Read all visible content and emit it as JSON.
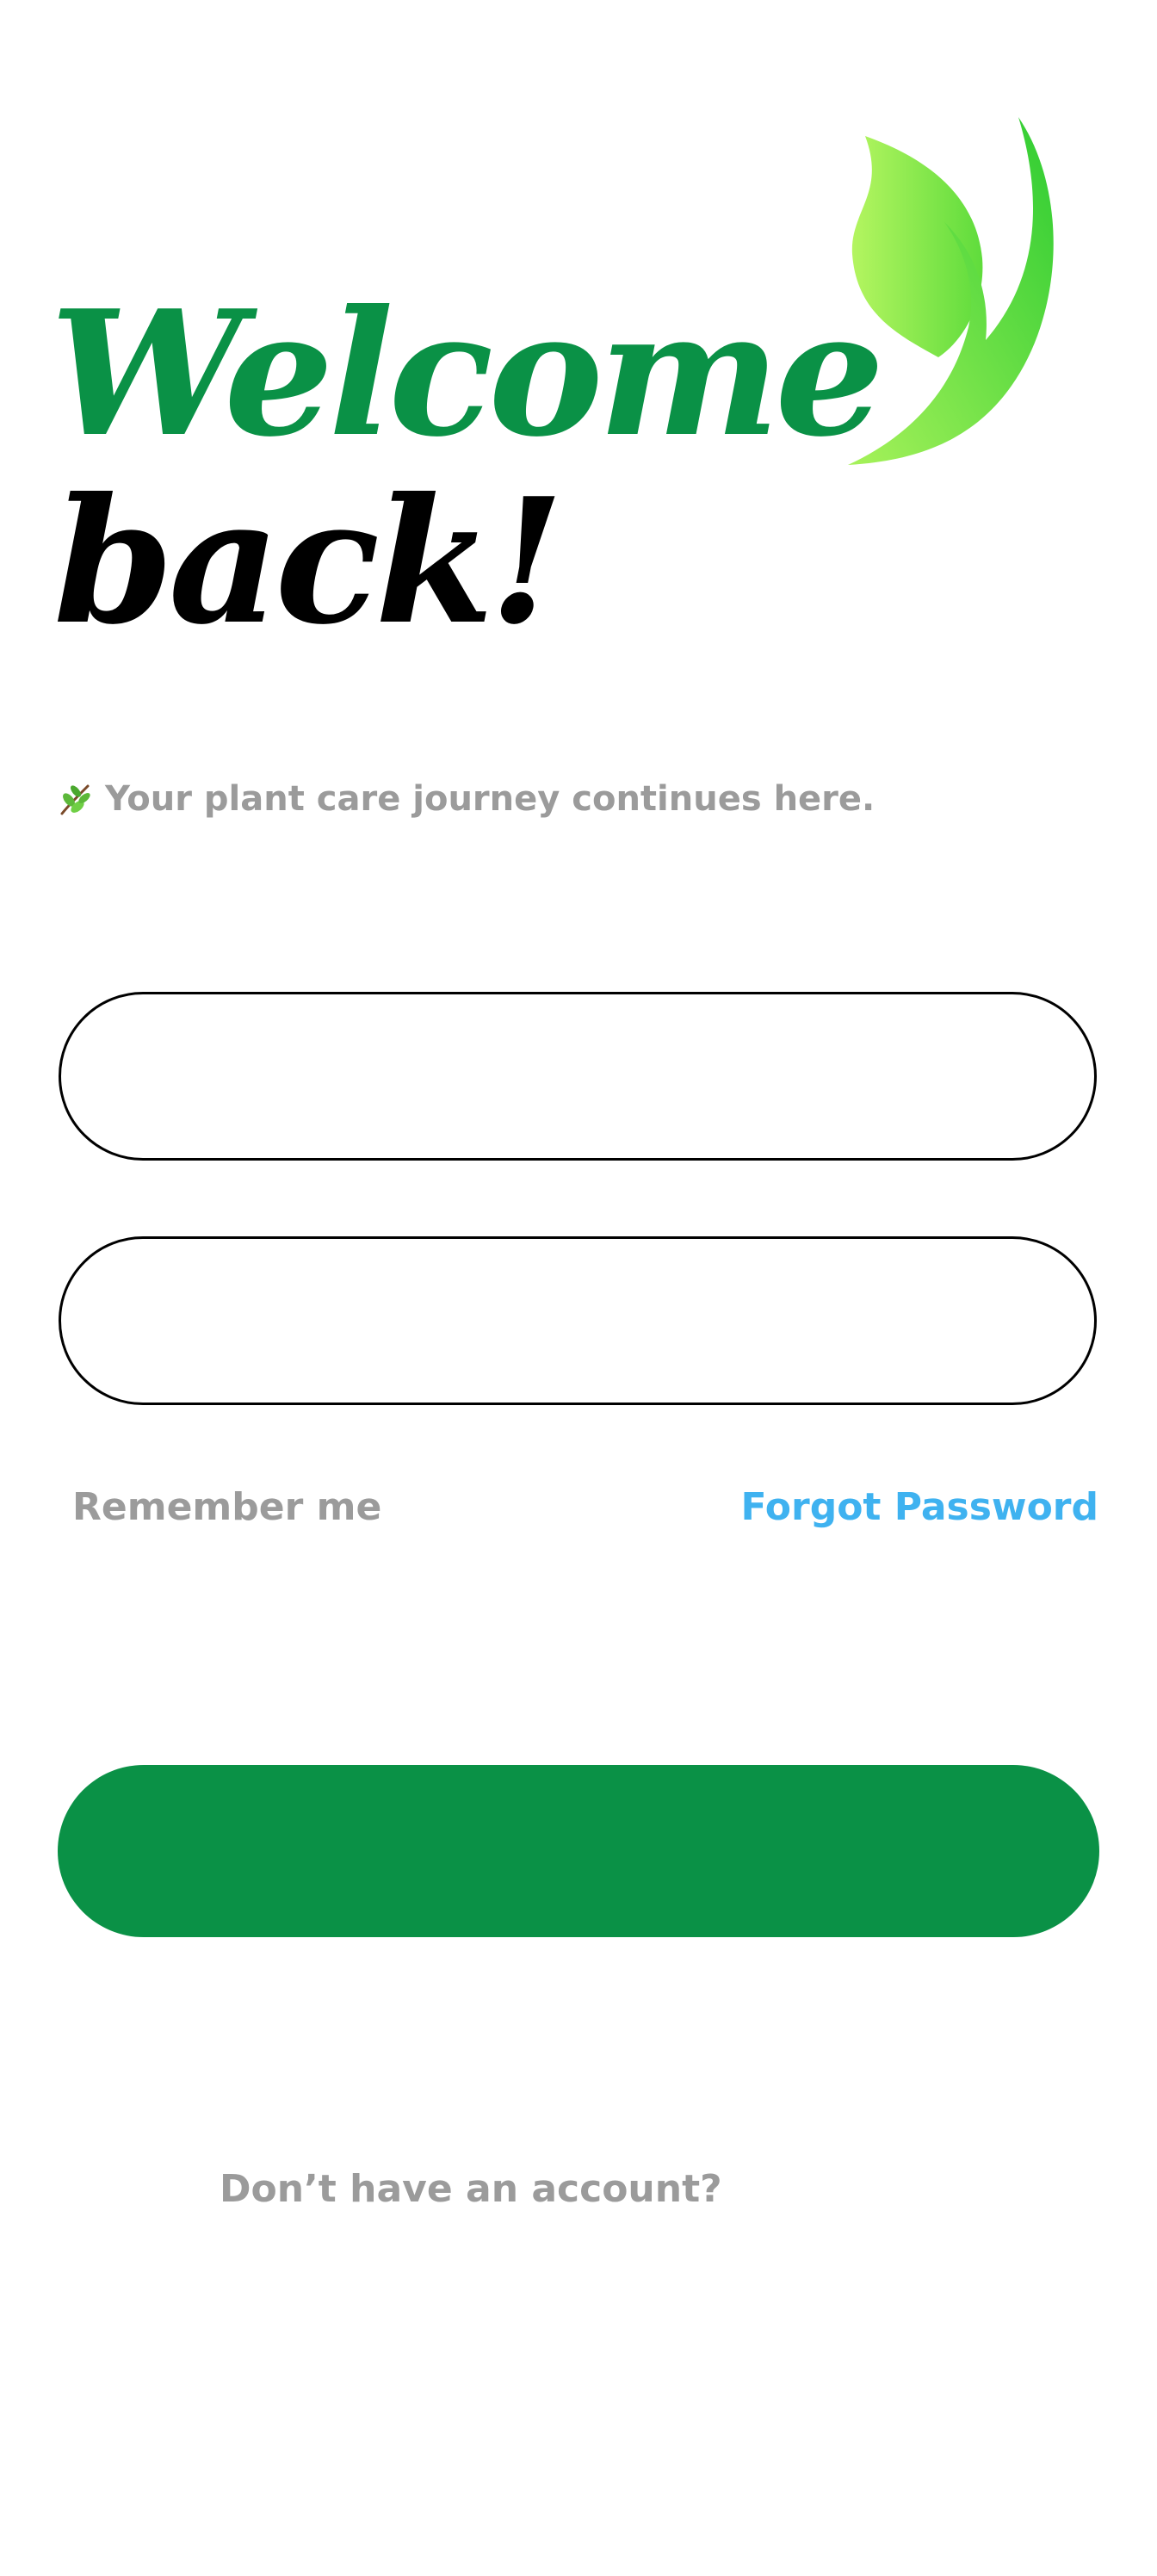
{
  "header": {
    "title_line1": "Welcome",
    "title_line2": "back!",
    "subtitle": "Your plant care journey continues here.",
    "logo_icon": "leaf-logo-icon",
    "subtitle_icon": "herb-icon"
  },
  "form": {
    "email_value": "",
    "password_value": "",
    "remember_label": "Remember me",
    "forgot_label": "Forgot Password",
    "submit_label": ""
  },
  "footer": {
    "signup_prompt": "Don’t have an account?"
  },
  "colors": {
    "brand_green": "#0a9146",
    "leaf_light": "#a7f25a",
    "leaf_dark": "#2ecc32",
    "link_blue": "#3fb2f0",
    "muted_gray": "#9b9b9b",
    "title_black": "#000000"
  }
}
